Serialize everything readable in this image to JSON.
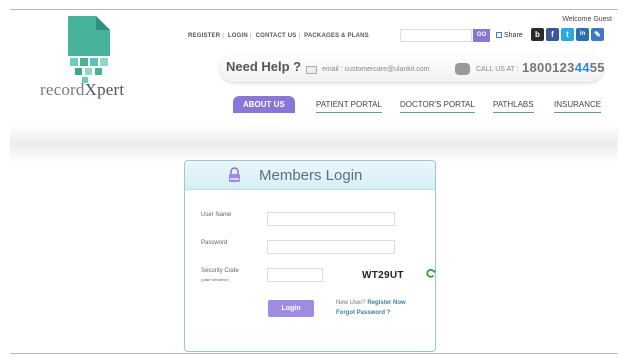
{
  "header": {
    "welcome": "Welcome Guest",
    "logo_text_a": "record",
    "logo_text_b": "Xpert",
    "top_nav": [
      "REGISTER",
      "LOGIN",
      "CONTACT US",
      "PACKAGES & PLANS"
    ],
    "search_value": "",
    "go_label": "GO",
    "share_label": "Share"
  },
  "social_icons": [
    {
      "name": "blog-icon",
      "glyph": "b",
      "color": "#2b2b2b"
    },
    {
      "name": "facebook-icon",
      "glyph": "f",
      "color": "#3b5998"
    },
    {
      "name": "twitter-icon",
      "glyph": "t",
      "color": "#29a9e1"
    },
    {
      "name": "linkedin-icon",
      "glyph": "in",
      "color": "#2b71b1"
    },
    {
      "name": "edit-icon",
      "glyph": "✎",
      "color": "#3d78c4"
    }
  ],
  "help": {
    "need_help": "Need Help ?",
    "email_text": "email : customercare@ulankit.com",
    "call_label": "CALL US AT :",
    "call_num_a": "1800123",
    "call_num_b": "44",
    "call_num_c": "55"
  },
  "main_nav": [
    "ABOUT US",
    "PATIENT PORTAL",
    "DOCTOR'S PORTAL",
    "PATHLABS",
    "INSURANCE"
  ],
  "login": {
    "title": "Members Login",
    "username_label": "User Name",
    "password_label": "Password",
    "security_label": "Security Code",
    "security_note": "(case sensitive)",
    "captcha": "WT29UT",
    "button": "Login",
    "new_user": "New User?",
    "register_now": "Register Now",
    "forgot": "Forgot Password ?"
  },
  "colors": {
    "accent": "#8a76d6",
    "brand_green": "#3aa88a",
    "brand_teal": "#5ec0c4"
  }
}
